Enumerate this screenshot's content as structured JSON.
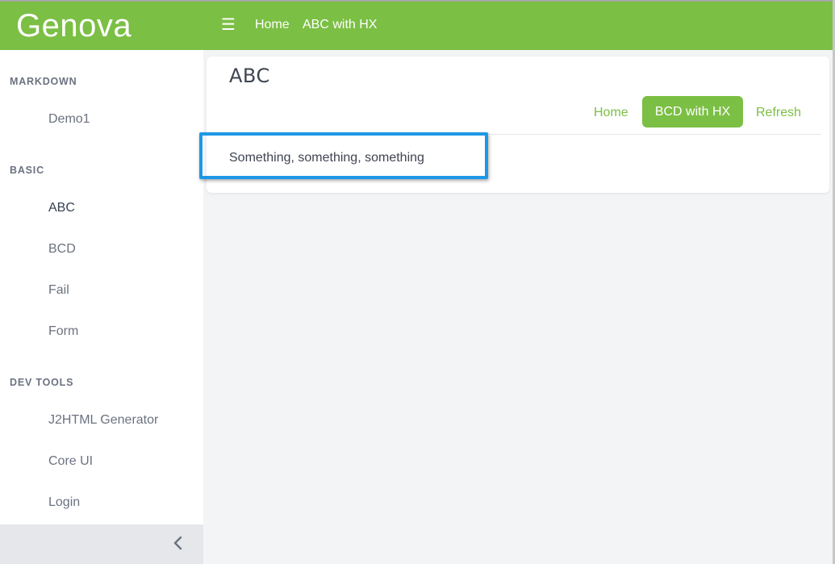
{
  "header": {
    "brand": "Genova",
    "menu_icon": "hamburger-icon",
    "breadcrumbs": [
      "Home",
      "ABC with HX"
    ]
  },
  "sidebar": {
    "sections": [
      {
        "title": "MARKDOWN",
        "items": [
          "Demo1"
        ]
      },
      {
        "title": "BASIC",
        "items": [
          "ABC",
          "BCD",
          "Fail",
          "Form"
        ]
      },
      {
        "title": "DEV TOOLS",
        "items": [
          "J2HTML Generator",
          "Core UI",
          "Login"
        ]
      }
    ],
    "active_item": "ABC",
    "collapse_icon": "chevron-left-icon"
  },
  "card": {
    "title": "ABC",
    "links": {
      "home": "Home",
      "primary_button": "BCD with HX",
      "refresh": "Refresh"
    },
    "content": "Something, something, something"
  },
  "colors": {
    "brand_green": "#7bbf44",
    "highlight_blue": "#1d98e6",
    "page_bg": "#f3f4f6"
  }
}
